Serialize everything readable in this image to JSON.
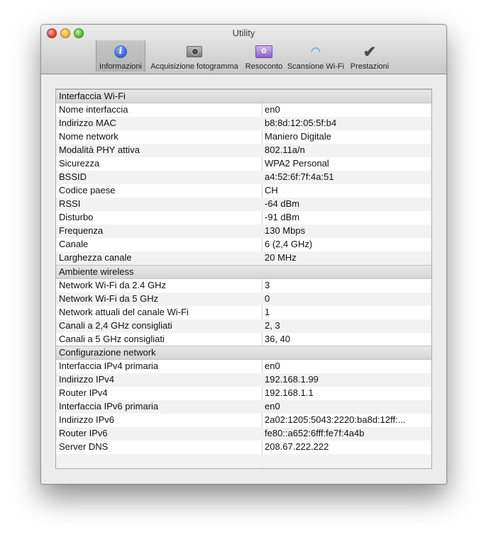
{
  "window": {
    "title": "Utility"
  },
  "toolbar": {
    "items": [
      {
        "label": "Informazioni",
        "icon": "info-icon",
        "selected": true
      },
      {
        "label": "Acquisizione fotogramma",
        "icon": "camera-icon",
        "selected": false
      },
      {
        "label": "Resoconto",
        "icon": "report-icon",
        "selected": false
      },
      {
        "label": "Scansione Wi-Fi",
        "icon": "wifi-icon",
        "selected": false
      },
      {
        "label": "Prestazioni",
        "icon": "checkmark-icon",
        "selected": false
      }
    ]
  },
  "sections": [
    {
      "title": "Interfaccia Wi-Fi",
      "rows": [
        {
          "name": "Nome interfaccia",
          "value": "en0"
        },
        {
          "name": "Indirizzo MAC",
          "value": "b8:8d:12:05:5f:b4"
        },
        {
          "name": "Nome network",
          "value": "Maniero Digitale"
        },
        {
          "name": "Modalità PHY attiva",
          "value": "802.11a/n"
        },
        {
          "name": "Sicurezza",
          "value": "WPA2 Personal"
        },
        {
          "name": "BSSID",
          "value": "a4:52:6f:7f:4a:51"
        },
        {
          "name": "Codice paese",
          "value": "CH"
        },
        {
          "name": "RSSI",
          "value": "-64 dBm"
        },
        {
          "name": "Disturbo",
          "value": "-91 dBm"
        },
        {
          "name": "Frequenza",
          "value": "130  Mbps"
        },
        {
          "name": "Canale",
          "value": "6 (2,4 GHz)"
        },
        {
          "name": "Larghezza canale",
          "value": "20 MHz"
        }
      ]
    },
    {
      "title": "Ambiente wireless",
      "rows": [
        {
          "name": "Network Wi-Fi da 2.4 GHz",
          "value": "3"
        },
        {
          "name": "Network Wi-Fi da 5 GHz",
          "value": "0"
        },
        {
          "name": "Network attuali del canale Wi-Fi",
          "value": "1"
        },
        {
          "name": "Canali a 2,4 GHz consigliati",
          "value": "2, 3"
        },
        {
          "name": "Canali a 5 GHz consigliati",
          "value": "36, 40"
        }
      ]
    },
    {
      "title": "Configurazione network",
      "rows": [
        {
          "name": "Interfaccia IPv4 primaria",
          "value": "en0"
        },
        {
          "name": "Indirizzo IPv4",
          "value": "192.168.1.99"
        },
        {
          "name": "Router IPv4",
          "value": "192.168.1.1"
        },
        {
          "name": "Interfaccia IPv6 primaria",
          "value": "en0"
        },
        {
          "name": "Indirizzo IPv6",
          "value": "2a02:1205:5043:2220:ba8d:12ff:..."
        },
        {
          "name": "Router IPv6",
          "value": "fe80::a652:6fff:fe7f:4a4b"
        },
        {
          "name": "Server DNS",
          "value": "208.67.222.222"
        }
      ]
    }
  ]
}
